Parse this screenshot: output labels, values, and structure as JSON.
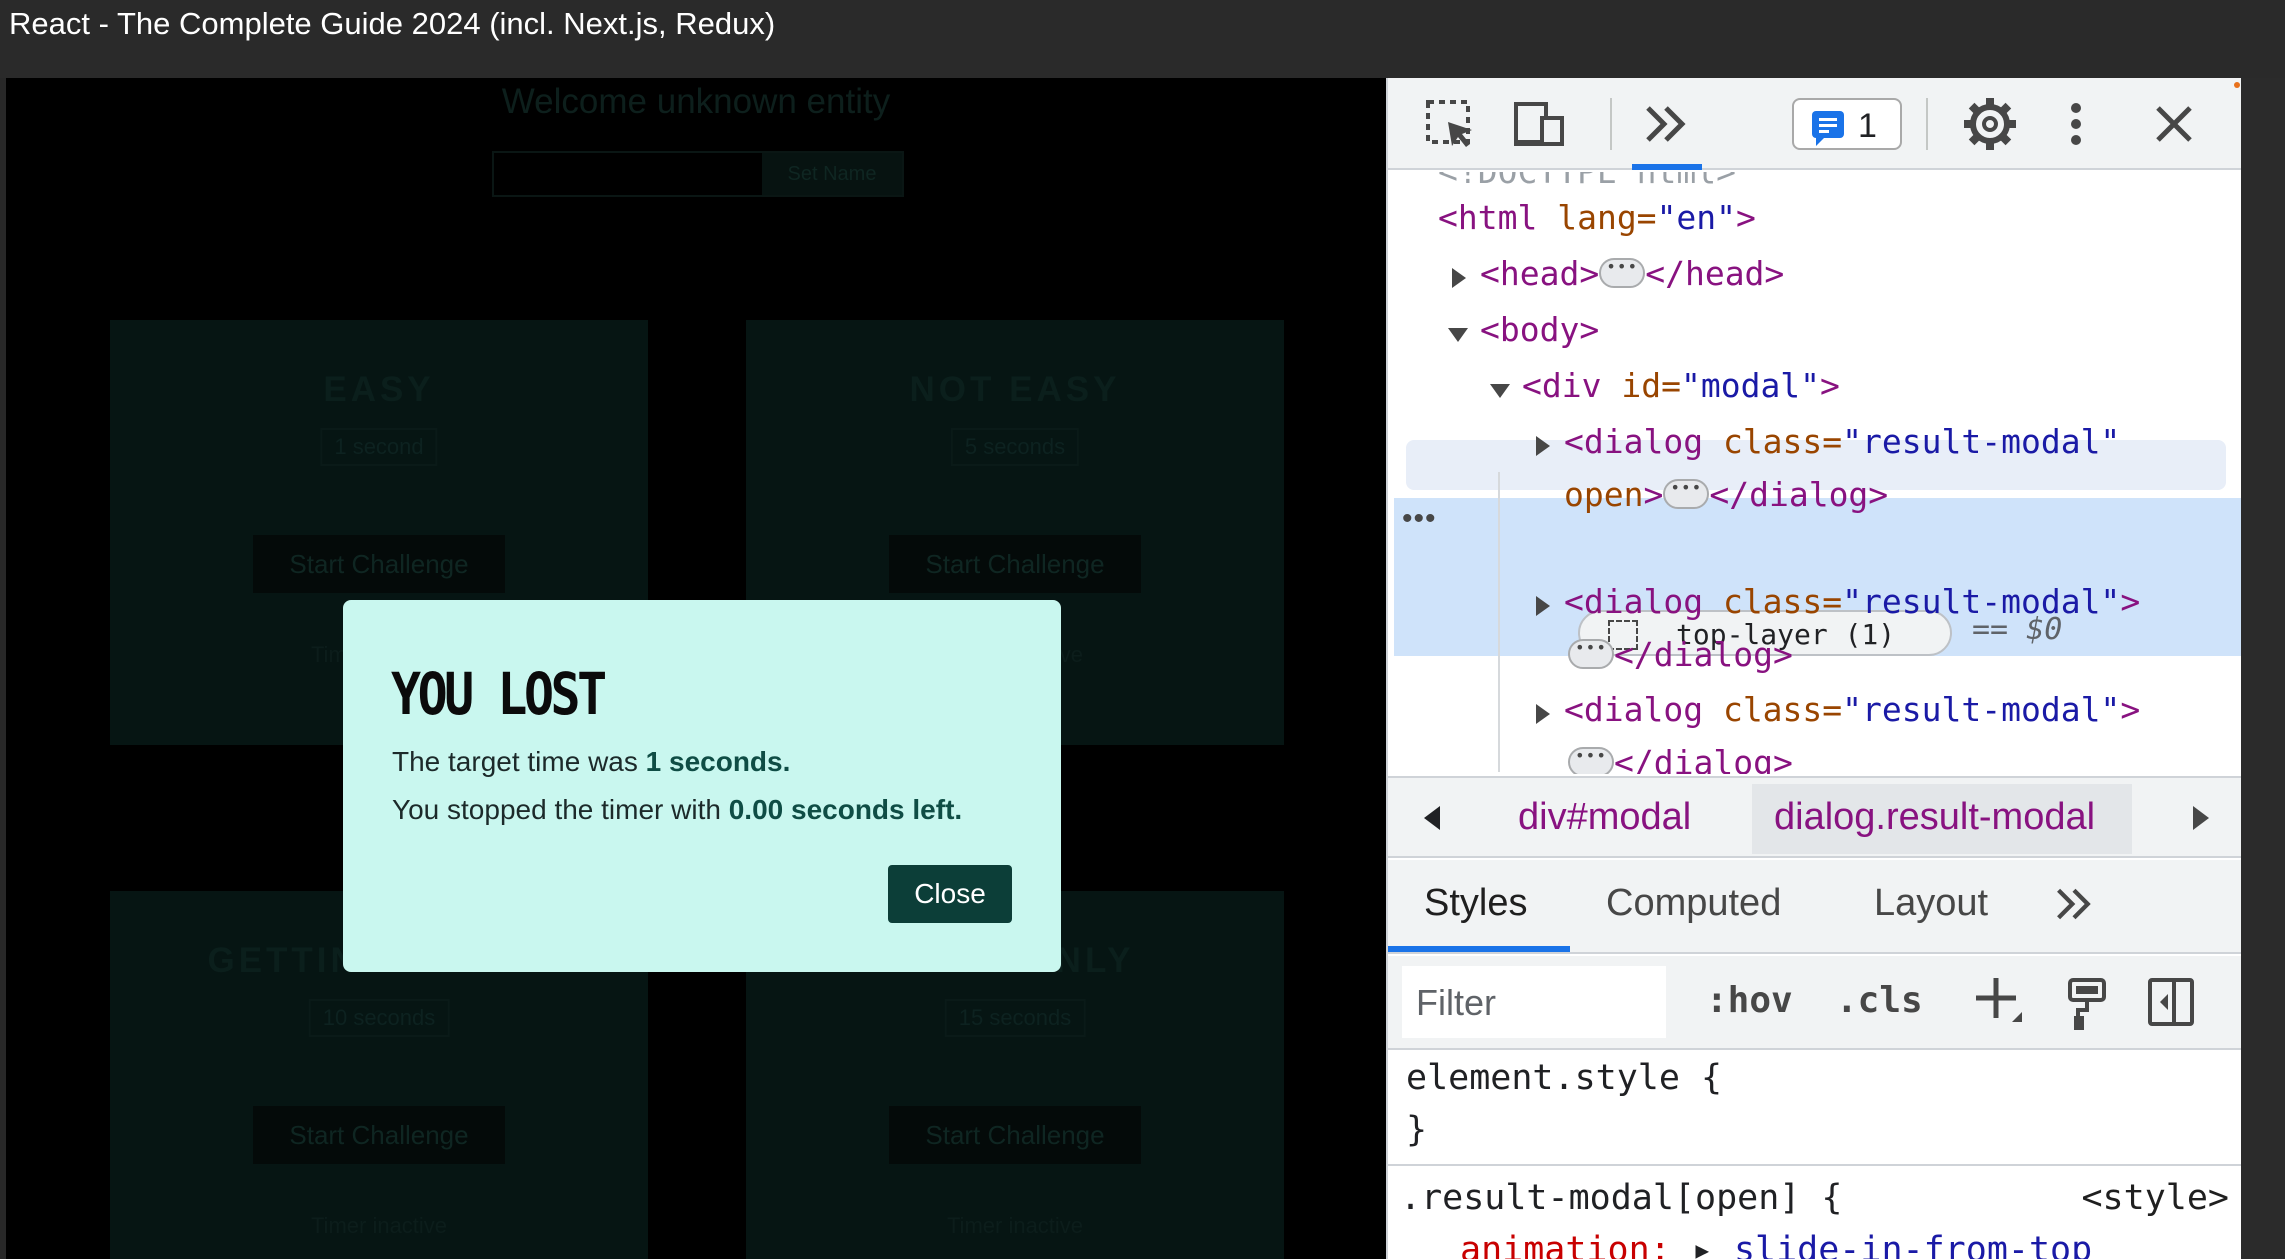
{
  "window": {
    "title": "React - The Complete Guide 2024 (incl. Next.js, Redux)"
  },
  "app": {
    "welcome": "Welcome unknown entity",
    "set_name_button": "Set Name",
    "cards": [
      {
        "title": "EASY",
        "subtitle": "1 second",
        "button": "Start Challenge",
        "status": "Timer inactive"
      },
      {
        "title": "NOT EASY",
        "subtitle": "5 seconds",
        "button": "Start Challenge",
        "status": "Timer inactive"
      },
      {
        "title": "GETTING TOUGH",
        "subtitle": "10 seconds",
        "button": "Start Challenge",
        "status": "Timer inactive"
      },
      {
        "title": "PROS ONLY",
        "subtitle": "15 seconds",
        "button": "Start Challenge",
        "status": "Timer inactive"
      }
    ],
    "modal": {
      "heading": "YOU LOST",
      "line1_prefix": "The target time was ",
      "line1_value": "1 seconds.",
      "line2_prefix": "You stopped the timer with ",
      "line2_value": "0.00 seconds left.",
      "close_button": "Close"
    }
  },
  "devtools": {
    "issues_count": "1",
    "tree": {
      "doctype": "<!DOCTYPE html>",
      "html_tag": "<html",
      "html_attr": " lang=",
      "html_val": "\"en\"",
      "html_close": ">",
      "head_open": "<head>",
      "head_close": "</head>",
      "body_open": "<body>",
      "div_open": "<div",
      "div_attr": " id=",
      "div_val": "\"modal\"",
      "div_close": ">",
      "dialog_open": "<dialog",
      "dialog_attr": " class=",
      "dialog_val": "\"result-modal\"",
      "dialog_open_attr": "open",
      "dialog_gt": ">",
      "dialog_close": "</dialog>",
      "top_layer": "top-layer (1)",
      "eq_dollar": "== ",
      "dollar": "$0"
    },
    "breadcrumbs": [
      "div#modal",
      "dialog.result-modal"
    ],
    "styles_tabs": [
      "Styles",
      "Computed",
      "Layout"
    ],
    "filter_placeholder": "Filter",
    "hov": ":hov",
    "cls": ".cls",
    "styles": {
      "element_style": "element.style {",
      "close_brace": "}",
      "rule_selector": ".result-modal[open] {",
      "rule_source": "<style>",
      "rule_prop": "animation:",
      "rule_val": "slide-in-from-top"
    }
  },
  "colors": {
    "modal_bg": "#c9f7ef",
    "close_button_bg": "#0c3e38",
    "accent_blue": "#1a73e8",
    "tag_purple": "#881280"
  }
}
